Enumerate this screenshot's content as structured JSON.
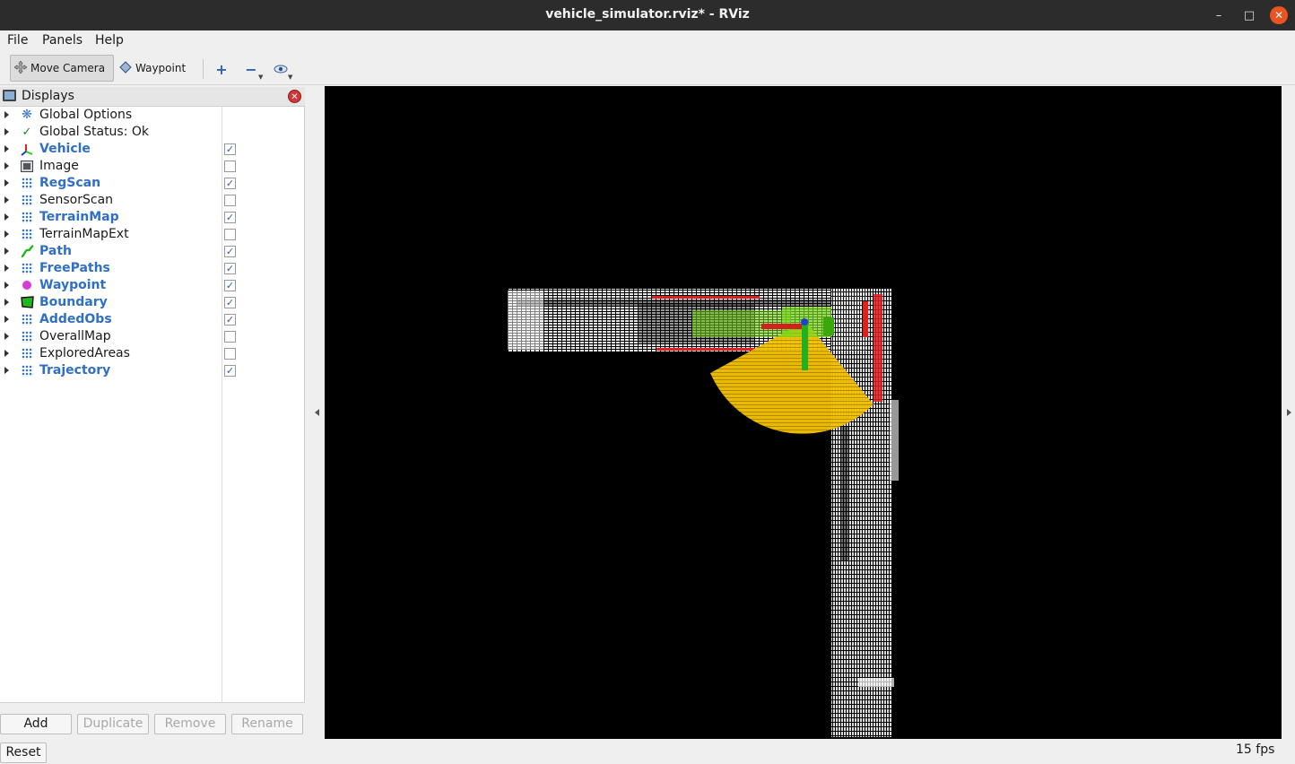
{
  "window": {
    "title": "vehicle_simulator.rviz* - RViz",
    "controls": [
      "minimize-icon",
      "maximize-icon",
      "close-icon"
    ]
  },
  "menu": [
    "File",
    "Panels",
    "Help"
  ],
  "toolbar": {
    "move_camera": "Move Camera",
    "waypoint": "Waypoint",
    "icons": [
      "plus-icon",
      "minus-icon",
      "eye-icon"
    ]
  },
  "displays_panel": {
    "title": "Displays",
    "items": [
      {
        "label": "Global Options",
        "icon": "gear-icon",
        "enabled": null
      },
      {
        "label": "Global Status: Ok",
        "icon": "check-icon",
        "enabled": null
      },
      {
        "label": "Vehicle",
        "icon": "axes-icon",
        "enabled": true
      },
      {
        "label": "Image",
        "icon": "image-icon",
        "enabled": false
      },
      {
        "label": "RegScan",
        "icon": "pointcloud-icon",
        "enabled": true
      },
      {
        "label": "SensorScan",
        "icon": "pointcloud-icon",
        "enabled": false
      },
      {
        "label": "TerrainMap",
        "icon": "pointcloud-icon",
        "enabled": true
      },
      {
        "label": "TerrainMapExt",
        "icon": "pointcloud-icon",
        "enabled": false
      },
      {
        "label": "Path",
        "icon": "path-icon",
        "enabled": true
      },
      {
        "label": "FreePaths",
        "icon": "pointcloud-icon",
        "enabled": true
      },
      {
        "label": "Waypoint",
        "icon": "sphere-icon",
        "enabled": true
      },
      {
        "label": "Boundary",
        "icon": "polygon-icon",
        "enabled": true
      },
      {
        "label": "AddedObs",
        "icon": "pointcloud-icon",
        "enabled": true
      },
      {
        "label": "OverallMap",
        "icon": "pointcloud-icon",
        "enabled": false
      },
      {
        "label": "ExploredAreas",
        "icon": "pointcloud-icon",
        "enabled": false
      },
      {
        "label": "Trajectory",
        "icon": "pointcloud-icon",
        "enabled": true
      }
    ],
    "buttons": {
      "add": "Add",
      "duplicate": "Duplicate",
      "remove": "Remove",
      "rename": "Rename"
    }
  },
  "status": {
    "reset": "Reset",
    "fps": "15 fps"
  },
  "colors": {
    "enabled_label": "#2f6fc4",
    "viewport_bg": "#000000",
    "point_cloud": "#ffffff",
    "scan": "#f5c400",
    "terrain_obstacle": "#e02020",
    "free_path": "#78d81e"
  }
}
